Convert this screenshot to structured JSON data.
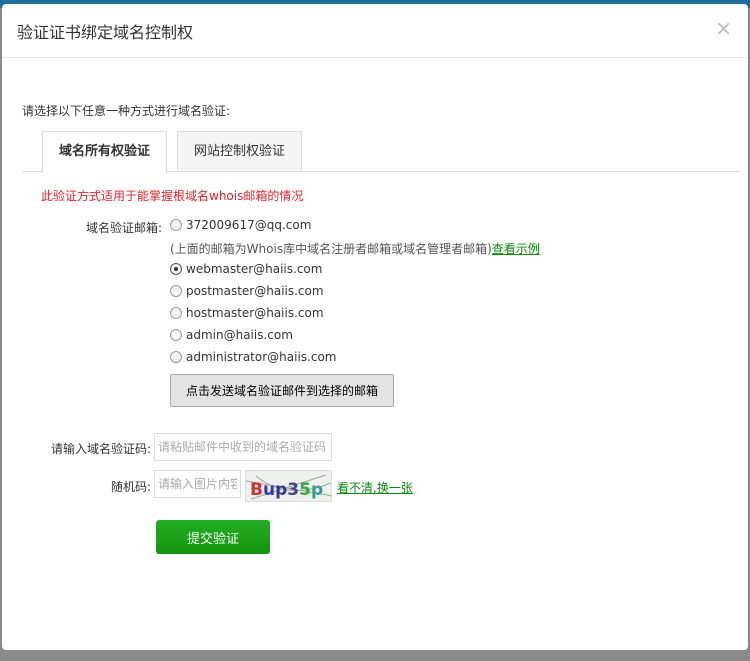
{
  "background": {
    "banner_text": "..."
  },
  "dialog": {
    "title": "验证证书绑定域名控制权",
    "close": "×"
  },
  "intro": "请选择以下任意一种方式进行域名验证:",
  "tabs": [
    {
      "label": "域名所有权验证",
      "active": true
    },
    {
      "label": "网站控制权验证",
      "active": false
    }
  ],
  "notice": "此验证方式适用于能掌握根域名whois邮箱的情况",
  "email": {
    "label": "域名验证邮箱:",
    "options": [
      "372009617@qq.com",
      "webmaster@haiis.com",
      "postmaster@haiis.com",
      "hostmaster@haiis.com",
      "admin@haiis.com",
      "administrator@haiis.com"
    ],
    "selected_index": 1,
    "note": "(上面的邮箱为Whois库中域名注册者邮箱或域名管理者邮箱)",
    "note_link": "查看示例"
  },
  "send_button": "点击发送域名验证邮件到选择的邮箱",
  "code": {
    "label": "请输入域名验证码:",
    "placeholder": "请粘贴邮件中收到的域名验证码"
  },
  "captcha": {
    "label": "随机码:",
    "placeholder": "请输入图片内容",
    "image_text": "Bup35p",
    "refresh": "看不清,换一张"
  },
  "submit": "提交验证"
}
